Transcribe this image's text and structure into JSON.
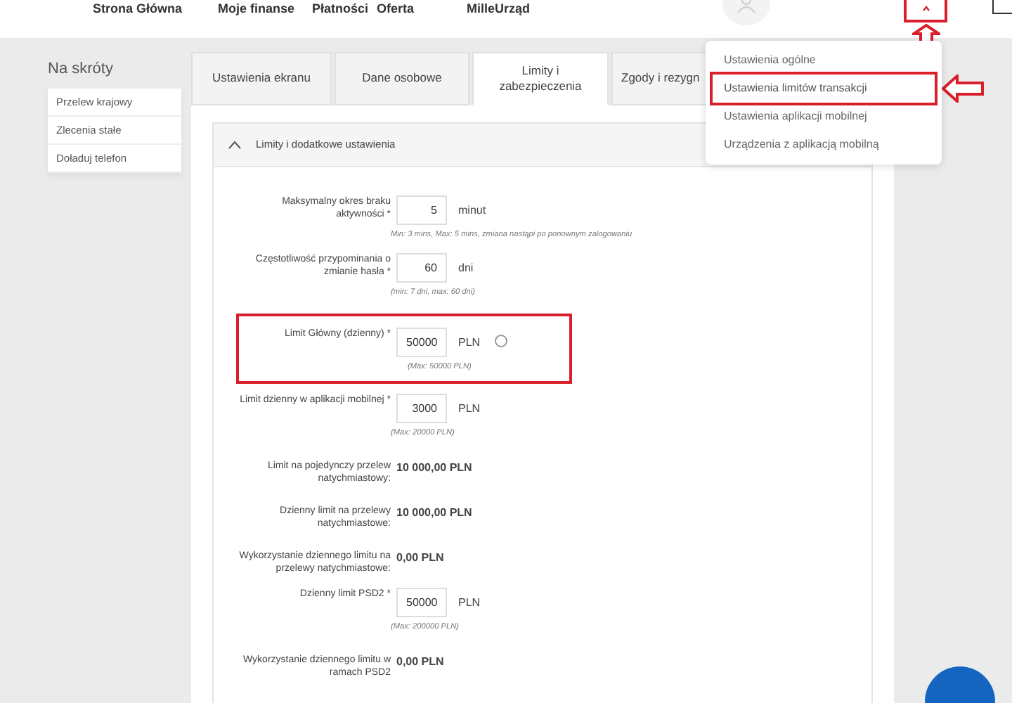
{
  "top_nav": {
    "items": [
      "Strona Główna",
      "Moje finanse",
      "Płatności",
      "Oferta",
      "MilleUrząd"
    ],
    "menu_toggle": {
      "expanded": true,
      "annotated": true
    }
  },
  "sidebar": {
    "title": "Na skróty",
    "items": [
      "Przelew krajowy",
      "Zlecenia stałe",
      "Doładuj telefon"
    ]
  },
  "tabs": [
    {
      "label": "Ustawienia ekranu",
      "selected": false
    },
    {
      "label": "Dane osobowe",
      "selected": false
    },
    {
      "label": "Limity i zabezpieczenia",
      "selected": true
    },
    {
      "label": "Zgody i rezygn",
      "selected": false
    }
  ],
  "section": {
    "title": "Limity i dodatkowe ustawienia",
    "expanded": true,
    "rows": [
      {
        "kind": "input",
        "label": "Maksymalny okres braku aktywności *",
        "value": "5",
        "unit": "minut",
        "hint": "Min: 3 mins, Max: 5 mins, zmiana nastąpi po ponownym zalogowaniu",
        "help": false,
        "annotated": false
      },
      {
        "kind": "input",
        "label": "Częstotliwość przypominania o zmianie hasła *",
        "value": "60",
        "unit": "dni",
        "hint": "(min: 7 dni, max: 60 dni)",
        "help": false,
        "annotated": false
      },
      {
        "kind": "input",
        "label": "Limit Główny (dzienny) *",
        "value": "50000",
        "unit": "PLN",
        "hint": "(Max: 50000 PLN)",
        "help": true,
        "annotated": true
      },
      {
        "kind": "input",
        "label": "Limit dzienny w aplikacji mobilnej *",
        "value": "3000",
        "unit": "PLN",
        "hint": "(Max: 20000 PLN)",
        "help": false,
        "annotated": false
      },
      {
        "kind": "readonly",
        "label": "Limit na pojedynczy przelew natychmiastowy:",
        "value": "10 000,00 PLN"
      },
      {
        "kind": "readonly",
        "label": "Dzienny limit na przelewy natychmiastowe:",
        "value": "10 000,00 PLN"
      },
      {
        "kind": "readonly",
        "label": "Wykorzystanie dziennego limitu na przelewy natychmiastowe:",
        "value": "0,00 PLN"
      },
      {
        "kind": "input",
        "label": "Dzienny limit PSD2 *",
        "value": "50000",
        "unit": "PLN",
        "hint": "(Max: 200000 PLN)",
        "help": false,
        "annotated": false
      },
      {
        "kind": "readonly",
        "label": "Wykorzystanie dziennego limitu w ramach PSD2",
        "value": "0,00 PLN"
      }
    ]
  },
  "settings_menu": {
    "items": [
      {
        "label": "Ustawienia ogólne",
        "annotated": false
      },
      {
        "label": "Ustawienia limitów transakcji",
        "annotated": true
      },
      {
        "label": "Ustawienia aplikacji mobilnej",
        "annotated": false
      },
      {
        "label": "Urządzenia z aplikacją mobilną",
        "annotated": false
      }
    ]
  }
}
